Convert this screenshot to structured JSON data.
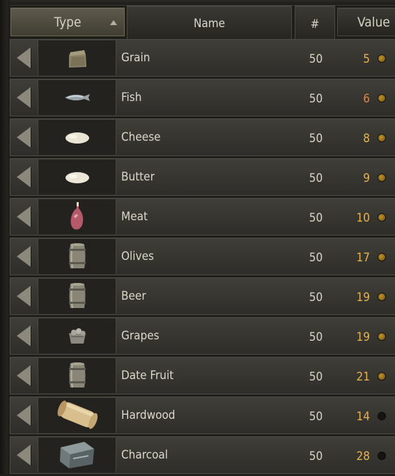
{
  "header": {
    "type_label": "Type",
    "name_label": "Name",
    "qty_label": "#",
    "value_label": "Value"
  },
  "rows": [
    {
      "name": "Grain",
      "qty": "50",
      "value": "5",
      "icon": "grain-sack-icon",
      "indicator": "on",
      "value_color": "#e9b34d"
    },
    {
      "name": "Fish",
      "qty": "50",
      "value": "6",
      "icon": "fish-icon",
      "indicator": "on",
      "value_color": "#e28544"
    },
    {
      "name": "Cheese",
      "qty": "50",
      "value": "8",
      "icon": "cheese-icon",
      "indicator": "on",
      "value_color": "#e9b34d"
    },
    {
      "name": "Butter",
      "qty": "50",
      "value": "9",
      "icon": "butter-icon",
      "indicator": "on",
      "value_color": "#e9b34d"
    },
    {
      "name": "Meat",
      "qty": "50",
      "value": "10",
      "icon": "meat-icon",
      "indicator": "on",
      "value_color": "#e9b34d"
    },
    {
      "name": "Olives",
      "qty": "50",
      "value": "17",
      "icon": "barrel-icon",
      "indicator": "on",
      "value_color": "#e9b34d"
    },
    {
      "name": "Beer",
      "qty": "50",
      "value": "19",
      "icon": "barrel-icon",
      "indicator": "on",
      "value_color": "#e9b34d"
    },
    {
      "name": "Grapes",
      "qty": "50",
      "value": "19",
      "icon": "grape-basket-icon",
      "indicator": "on",
      "value_color": "#e9b34d"
    },
    {
      "name": "Date Fruit",
      "qty": "50",
      "value": "21",
      "icon": "barrel-icon",
      "indicator": "on",
      "value_color": "#e9b34d"
    },
    {
      "name": "Hardwood",
      "qty": "50",
      "value": "14",
      "icon": "hardwood-log-icon",
      "indicator": "off",
      "value_color": "#e9b34d"
    },
    {
      "name": "Charcoal",
      "qty": "50",
      "value": "28",
      "icon": "charcoal-icon",
      "indicator": "off",
      "value_color": "#e9b34d"
    }
  ]
}
